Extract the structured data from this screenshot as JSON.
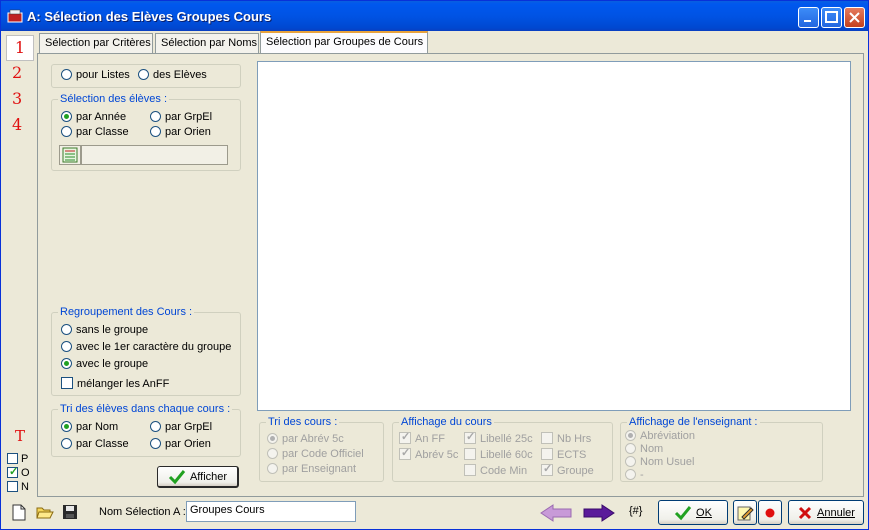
{
  "window": {
    "title": "A: Sélection des Elèves Groupes Cours"
  },
  "side_numbers": [
    "1",
    "2",
    "3",
    "4"
  ],
  "side_letter": "T",
  "side_checks": [
    {
      "label": "P",
      "checked": false
    },
    {
      "label": "O",
      "checked": true
    },
    {
      "label": "N",
      "checked": false
    }
  ],
  "tabs": [
    "Sélection par Critères",
    "Sélection par Noms",
    "Sélection par Groupes de Cours"
  ],
  "source": {
    "options": [
      "pour Listes",
      "des Elèves"
    ]
  },
  "selection_eleves": {
    "legend": "Sélection des élèves :",
    "options": [
      "par Année",
      "par GrpEl",
      "par Classe",
      "par Orien"
    ],
    "selected": "par Année",
    "field_value": ""
  },
  "regroupement": {
    "legend": "Regroupement des Cours :",
    "options": [
      "sans le groupe",
      "avec le 1er caractère du groupe",
      "avec le groupe"
    ],
    "selected": "avec le groupe",
    "checkbox": "mélanger les AnFF"
  },
  "tri_eleves": {
    "legend": "Tri des élèves dans chaque cours :",
    "options": [
      "par Nom",
      "par GrpEl",
      "par Classe",
      "par Orien"
    ],
    "selected": "par Nom"
  },
  "afficher_button": "Afficher",
  "tri_cours": {
    "legend": "Tri des cours :",
    "options": [
      "par Abrév 5c",
      "par Code Officiel",
      "par Enseignant"
    ],
    "selected": "par Abrév 5c"
  },
  "affichage_cours": {
    "legend": "Affichage du cours",
    "items": [
      {
        "label": "An FF",
        "checked": true
      },
      {
        "label": "Libellé 25c",
        "checked": true
      },
      {
        "label": "Nb Hrs",
        "checked": false
      },
      {
        "label": "Abrév 5c",
        "checked": true
      },
      {
        "label": "Libellé 60c",
        "checked": false
      },
      {
        "label": "ECTS",
        "checked": false
      },
      {
        "label": "Code Min",
        "checked": false
      },
      {
        "label": "Groupe",
        "checked": true
      }
    ]
  },
  "affichage_enseignant": {
    "legend": "Affichage de l'enseignant :",
    "options": [
      "Abréviation",
      "Nom",
      "Nom Usuel",
      "-"
    ],
    "selected": "Abréviation"
  },
  "bottom": {
    "name_label": "Nom Sélection A :",
    "name_value": "Groupes Cours",
    "hash_label": "{#}",
    "ok_label": "OK",
    "cancel_label": "Annuler"
  },
  "colors": {
    "accent": "#0046d5",
    "number_red": "#e01010",
    "arrow_purple": "#7a2aa8",
    "check_green": "#21a121"
  }
}
